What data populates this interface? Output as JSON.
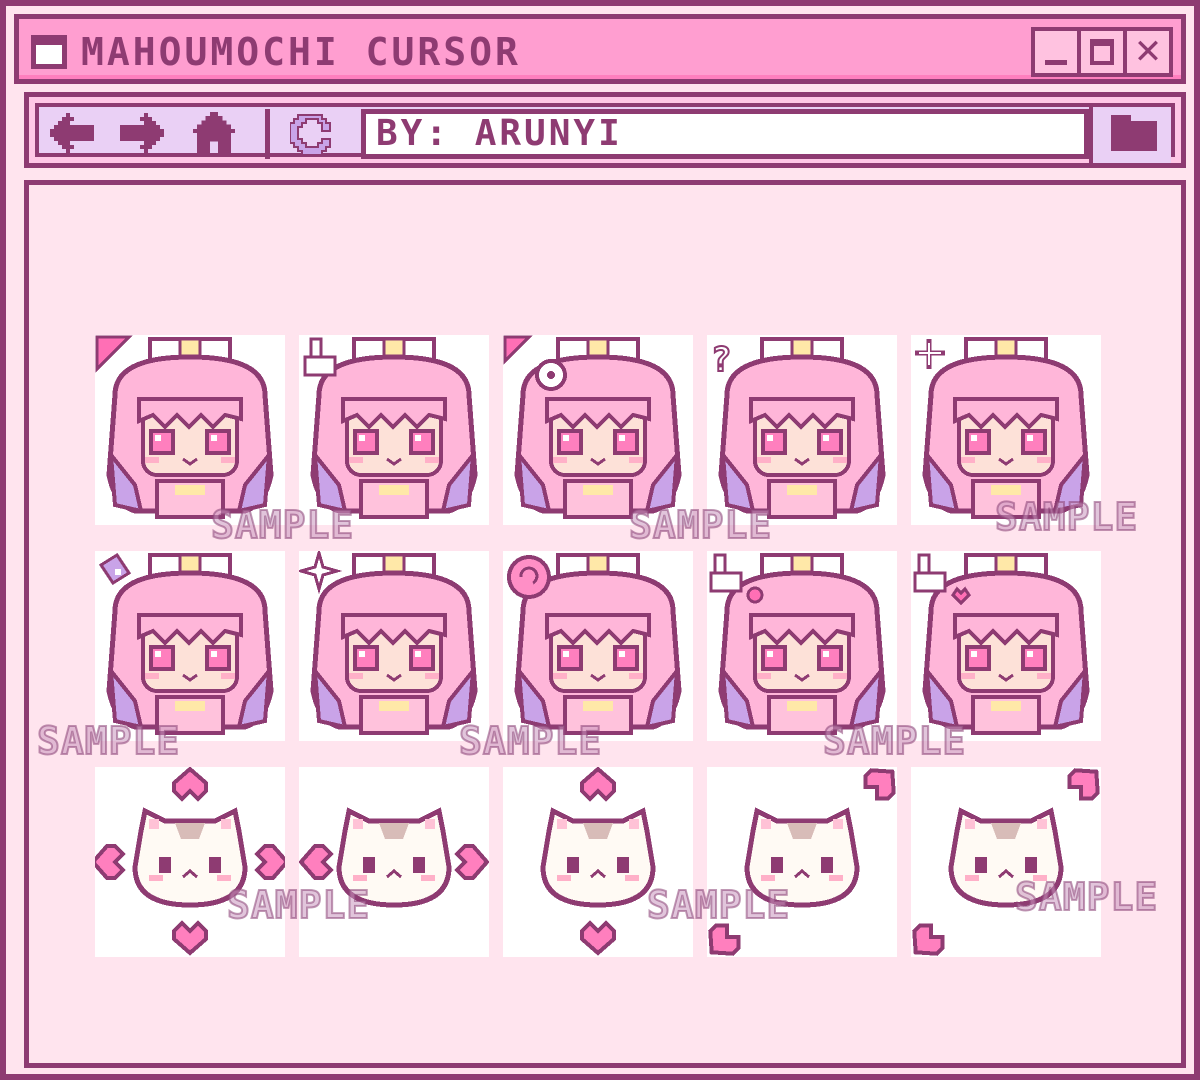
{
  "window": {
    "title": "MAHOUMOCHI CURSOR"
  },
  "toolbar": {
    "back_icon": "arrow-left-icon",
    "forward_icon": "arrow-right-icon",
    "home_icon": "home-icon",
    "refresh_icon": "refresh-icon",
    "address_value": "BY: ARUNYI",
    "folder_icon": "folder-icon"
  },
  "cursor_grid": {
    "rows": [
      {
        "tiles": [
          {
            "name": "girl-cursor-normal",
            "badge": "arrow-pointer"
          },
          {
            "name": "girl-cursor-link-hand",
            "badge": "pointing-hand"
          },
          {
            "name": "girl-cursor-busy",
            "badge": "clock"
          },
          {
            "name": "girl-cursor-help",
            "badge": "question"
          },
          {
            "name": "girl-cursor-precision",
            "badge": "crosshair"
          }
        ]
      },
      {
        "tiles": [
          {
            "name": "girl-cursor-handwriting",
            "badge": "pencil"
          },
          {
            "name": "girl-cursor-unavailable",
            "badge": "sparkle"
          },
          {
            "name": "girl-cursor-working",
            "badge": "swirl"
          },
          {
            "name": "girl-cursor-pin",
            "badge": "hand-with-pin"
          },
          {
            "name": "girl-cursor-person",
            "badge": "hand-with-heart"
          }
        ]
      },
      {
        "tiles": [
          {
            "name": "cat-cursor-move",
            "badge": "four-heart-arrows"
          },
          {
            "name": "cat-cursor-horizontal-resize",
            "badge": "left-right-hearts"
          },
          {
            "name": "cat-cursor-vertical-resize",
            "badge": "up-down-hearts"
          },
          {
            "name": "cat-cursor-diagonal-resize-1",
            "badge": "diagonal-hearts"
          },
          {
            "name": "cat-cursor-diagonal-resize-2",
            "badge": "diagonal-hearts"
          }
        ]
      }
    ],
    "watermark_text": "SAMPLE"
  },
  "colors": {
    "outline": "#8e3b72",
    "titlebar": "#ff9ed0",
    "panel": "#ffe4ee",
    "toolbar": "#ead0f5",
    "hair_pink": "#ffb6d9",
    "hair_purple": "#c9a3e8",
    "skin": "#fde1d8"
  }
}
